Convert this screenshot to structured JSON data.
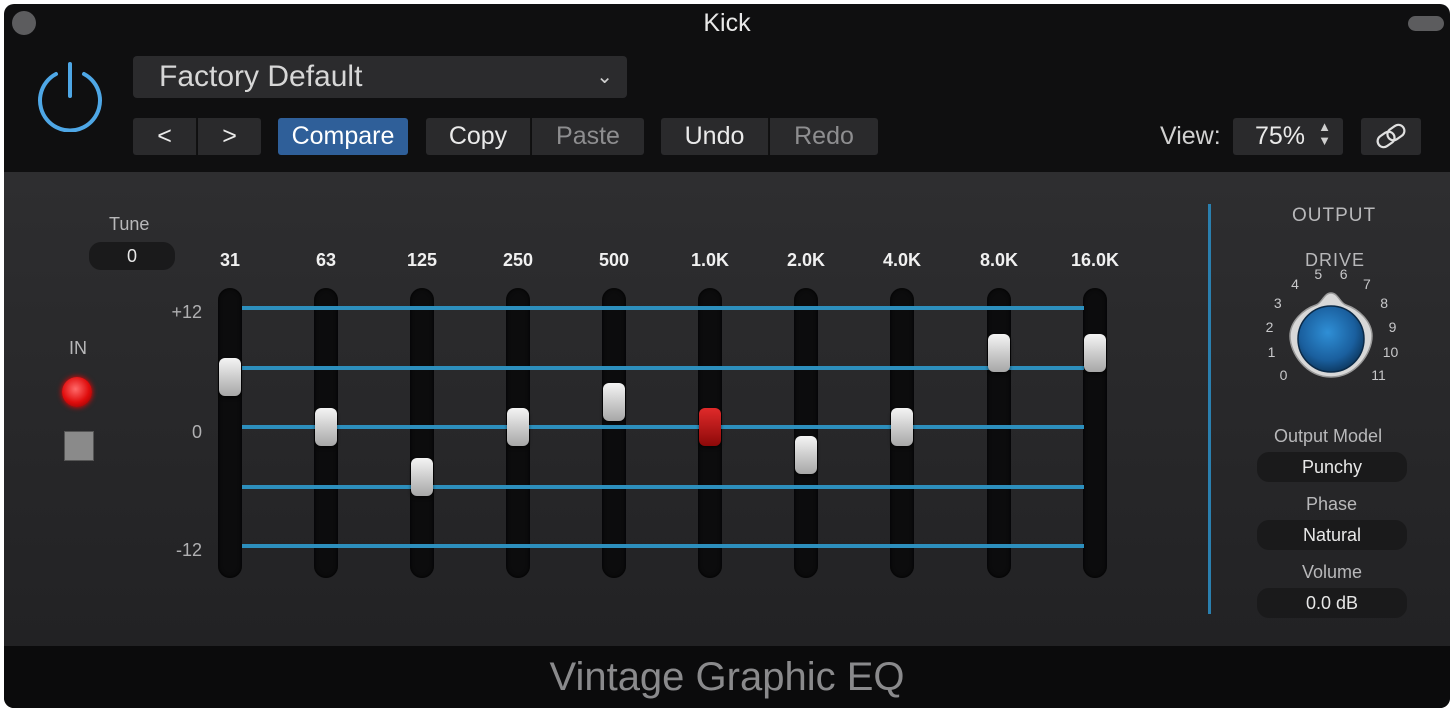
{
  "window": {
    "title": "Kick"
  },
  "header": {
    "preset": "Factory Default",
    "nav_prev": "<",
    "nav_next": ">",
    "compare": "Compare",
    "copy": "Copy",
    "paste": "Paste",
    "undo": "Undo",
    "redo": "Redo",
    "view_label": "View:",
    "view_value": "75%"
  },
  "tune": {
    "label": "Tune",
    "value": "0"
  },
  "input": {
    "label": "IN"
  },
  "scale_labels": [
    "+12",
    "0",
    "-12"
  ],
  "bands": [
    {
      "freq": "31",
      "gain_db": 5
    },
    {
      "freq": "63",
      "gain_db": 0
    },
    {
      "freq": "125",
      "gain_db": -5
    },
    {
      "freq": "250",
      "gain_db": 0
    },
    {
      "freq": "500",
      "gain_db": 2.5
    },
    {
      "freq": "1.0K",
      "gain_db": 0
    },
    {
      "freq": "2.0K",
      "gain_db": -2.8
    },
    {
      "freq": "4.0K",
      "gain_db": 0
    },
    {
      "freq": "8.0K",
      "gain_db": 7.5
    },
    {
      "freq": "16.0K",
      "gain_db": 7.5
    }
  ],
  "output": {
    "heading": "OUTPUT",
    "drive_label": "DRIVE",
    "drive_scale": [
      "0",
      "1",
      "2",
      "3",
      "4",
      "5",
      "6",
      "7",
      "8",
      "9",
      "10",
      "11"
    ],
    "drive_value": 5,
    "model_label": "Output Model",
    "model_value": "Punchy",
    "phase_label": "Phase",
    "phase_value": "Natural",
    "volume_label": "Volume",
    "volume_value": "0.0 dB"
  },
  "footer": {
    "plugin_name": "Vintage Graphic EQ"
  },
  "colors": {
    "accent_blue": "#2d8fbd",
    "compare_blue": "#2f5f99",
    "led_red": "#e00d0d"
  }
}
